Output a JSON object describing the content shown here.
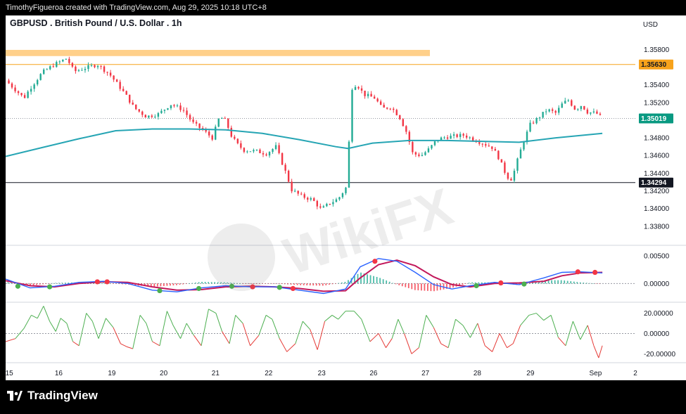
{
  "header": {
    "caption": "TimothyFigueroa created with TradingView.com, Aug 29, 2025 10:18 UTC+8"
  },
  "chart": {
    "title": "GBPUSD . British Pound / U.S. Dollar . 1h",
    "currency": "USD"
  },
  "footer": {
    "brand": "TradingView"
  },
  "watermark": {
    "text": "WikiFX"
  },
  "colors": {
    "up": "#22ab94",
    "down": "#f23645",
    "ma": "#26a5b4",
    "resistance_zone": "#ffd08a",
    "resistance_badge": "#f7a21b",
    "last_price_badge": "#089981",
    "support_badge": "#131722",
    "macd_line": "#2962ff",
    "signal_line": "#c2185b",
    "osc_up": "#4caf50",
    "osc_down": "#e53935"
  },
  "chart_data": {
    "type": "candlestick",
    "symbol": "GBPUSD",
    "timeframe": "1h",
    "y_ticks": [
      "1.35800",
      "1.35400",
      "1.35200",
      "1.34800",
      "1.34600",
      "1.34400",
      "1.34200",
      "1.34000",
      "1.33800"
    ],
    "ylim": [
      1.336,
      1.3593
    ],
    "x_ticks": [
      "15",
      "16",
      "19",
      "20",
      "21",
      "22",
      "23",
      "26",
      "27",
      "28",
      "29",
      "Sep",
      "2"
    ],
    "price_labels": {
      "resistance": "1.35630",
      "last": "1.35019",
      "support": "1.34294"
    },
    "levels": {
      "resistance": 1.3563,
      "last": 1.35019,
      "support": 1.34294,
      "zone_high": 1.35795,
      "zone_low": 1.35725
    },
    "price_path": [
      [
        0,
        1.3545
      ],
      [
        1.5,
        1.3525
      ],
      [
        2,
        1.3536
      ],
      [
        3,
        1.3554
      ],
      [
        4,
        1.3563
      ],
      [
        5,
        1.357
      ],
      [
        5.6,
        1.3555
      ],
      [
        6.5,
        1.3559
      ],
      [
        7.5,
        1.3563
      ],
      [
        8.5,
        1.3552
      ],
      [
        9.3,
        1.3538
      ],
      [
        9.8,
        1.3529
      ],
      [
        10.5,
        1.3514
      ],
      [
        11.5,
        1.3504
      ],
      [
        12.5,
        1.3507
      ],
      [
        13.5,
        1.3518
      ],
      [
        14.5,
        1.3512
      ],
      [
        15.3,
        1.3497
      ],
      [
        16.2,
        1.3488
      ],
      [
        16.9,
        1.348
      ],
      [
        17.5,
        1.3504
      ],
      [
        18,
        1.3499
      ],
      [
        18.5,
        1.3481
      ],
      [
        19,
        1.3472
      ],
      [
        19.5,
        1.3466
      ],
      [
        20.5,
        1.3465
      ],
      [
        21.3,
        1.3462
      ],
      [
        22.1,
        1.347
      ],
      [
        22.8,
        1.3445
      ],
      [
        23.4,
        1.3421
      ],
      [
        24.2,
        1.3414
      ],
      [
        25.1,
        1.341
      ],
      [
        25.8,
        1.3399
      ],
      [
        26.5,
        1.3406
      ],
      [
        27.2,
        1.3411
      ],
      [
        27.9,
        1.3425
      ],
      [
        28.3,
        1.3536
      ],
      [
        28.7,
        1.3541
      ],
      [
        29.3,
        1.3529
      ],
      [
        30.2,
        1.3525
      ],
      [
        30.8,
        1.3513
      ],
      [
        31.5,
        1.3515
      ],
      [
        32.2,
        1.3504
      ],
      [
        32.8,
        1.3486
      ],
      [
        33.3,
        1.3462
      ],
      [
        34,
        1.346
      ],
      [
        34.6,
        1.3467
      ],
      [
        35.3,
        1.3478
      ],
      [
        36,
        1.3481
      ],
      [
        36.8,
        1.3482
      ],
      [
        37.5,
        1.3483
      ],
      [
        38.3,
        1.3478
      ],
      [
        39,
        1.3474
      ],
      [
        39.8,
        1.3469
      ],
      [
        40.3,
        1.3458
      ],
      [
        41,
        1.3436
      ],
      [
        41.4,
        1.3433
      ],
      [
        41.8,
        1.3452
      ],
      [
        42.3,
        1.3474
      ],
      [
        42.9,
        1.3495
      ],
      [
        43.6,
        1.3503
      ],
      [
        44.3,
        1.3512
      ],
      [
        45,
        1.3508
      ],
      [
        45.5,
        1.3518
      ],
      [
        46,
        1.3523
      ],
      [
        46.6,
        1.3512
      ],
      [
        47.1,
        1.3517
      ],
      [
        47.6,
        1.3509
      ],
      [
        48.3,
        1.3508
      ],
      [
        48.8,
        1.3502
      ]
    ],
    "ma_path": [
      [
        0,
        1.3459
      ],
      [
        3,
        1.3469
      ],
      [
        6,
        1.3479
      ],
      [
        9,
        1.3488
      ],
      [
        12,
        1.349
      ],
      [
        15,
        1.349
      ],
      [
        18,
        1.3489
      ],
      [
        21,
        1.3485
      ],
      [
        24,
        1.3478
      ],
      [
        27,
        1.347
      ],
      [
        28,
        1.3468
      ],
      [
        30,
        1.3474
      ],
      [
        33,
        1.3477
      ],
      [
        36,
        1.3477
      ],
      [
        39,
        1.3476
      ],
      [
        42,
        1.3475
      ],
      [
        45,
        1.348
      ],
      [
        48.8,
        1.3485
      ]
    ],
    "x_span": [
      0,
      51.5
    ],
    "macd": {
      "y_ticks": [
        "0.00500",
        "0.00000"
      ],
      "ylim": [
        -0.003,
        0.0065
      ],
      "macd_path": [
        [
          0,
          0.0008
        ],
        [
          2,
          -0.0008
        ],
        [
          4,
          -0.0005
        ],
        [
          6,
          0.0002
        ],
        [
          8,
          0.0004
        ],
        [
          10,
          0.0
        ],
        [
          12,
          -0.0012
        ],
        [
          14,
          -0.0015
        ],
        [
          16,
          -0.0008
        ],
        [
          18,
          -0.0004
        ],
        [
          20,
          -0.0006
        ],
        [
          22,
          -0.0006
        ],
        [
          24,
          -0.0012
        ],
        [
          26,
          -0.0018
        ],
        [
          27.8,
          -0.001
        ],
        [
          29,
          0.003
        ],
        [
          30.5,
          0.0045
        ],
        [
          32,
          0.004
        ],
        [
          33.5,
          0.002
        ],
        [
          35,
          -0.0002
        ],
        [
          36.5,
          -0.001
        ],
        [
          38,
          -0.0004
        ],
        [
          40,
          0.0002
        ],
        [
          42,
          -0.0002
        ],
        [
          44,
          0.001
        ],
        [
          45.5,
          0.002
        ],
        [
          47,
          0.0021
        ],
        [
          48.8,
          0.0019
        ]
      ],
      "signal_path": [
        [
          0,
          0.0005
        ],
        [
          2,
          -0.0004
        ],
        [
          4,
          -0.0006
        ],
        [
          6,
          0.0
        ],
        [
          8,
          0.0003
        ],
        [
          10,
          0.0002
        ],
        [
          12,
          -0.0006
        ],
        [
          14,
          -0.0012
        ],
        [
          16,
          -0.0011
        ],
        [
          18,
          -0.0006
        ],
        [
          20,
          -0.0005
        ],
        [
          22,
          -0.0006
        ],
        [
          24,
          -0.0009
        ],
        [
          26,
          -0.0014
        ],
        [
          27.8,
          -0.0013
        ],
        [
          29,
          0.001
        ],
        [
          30.5,
          0.0034
        ],
        [
          32,
          0.0042
        ],
        [
          33.5,
          0.0032
        ],
        [
          35,
          0.0012
        ],
        [
          36.5,
          -0.0002
        ],
        [
          38,
          -0.0006
        ],
        [
          40,
          0.0
        ],
        [
          42,
          0.0001
        ],
        [
          44,
          0.0004
        ],
        [
          45.5,
          0.0014
        ],
        [
          47,
          0.0019
        ],
        [
          48.8,
          0.002
        ]
      ],
      "cross_markers": [
        [
          1,
          -0.0005,
          "up"
        ],
        [
          3.6,
          -0.0006,
          "up"
        ],
        [
          7.5,
          0.0003,
          "down"
        ],
        [
          8.3,
          0.0003,
          "down"
        ],
        [
          12.6,
          -0.0013,
          "up"
        ],
        [
          15.8,
          -0.0009,
          "up"
        ],
        [
          18.5,
          -0.0005,
          "up"
        ],
        [
          20.2,
          -0.0006,
          "down"
        ],
        [
          22.4,
          -0.0007,
          "up"
        ],
        [
          23.5,
          -0.0009,
          "down"
        ],
        [
          30.2,
          0.004,
          "down"
        ],
        [
          38.5,
          -0.0004,
          "up"
        ],
        [
          40.5,
          0.0001,
          "down"
        ],
        [
          42.4,
          -0.0001,
          "up"
        ],
        [
          46.8,
          0.0021,
          "down"
        ],
        [
          48.2,
          0.002,
          "down"
        ]
      ]
    },
    "oscillator": {
      "y_ticks": [
        "20.00000",
        "0.00000",
        "-20.00000"
      ],
      "ylim": [
        -26,
        28
      ],
      "path": [
        [
          0,
          -8
        ],
        [
          0.8,
          -5
        ],
        [
          1.5,
          5
        ],
        [
          2.1,
          18
        ],
        [
          2.6,
          15
        ],
        [
          3.1,
          27
        ],
        [
          3.6,
          12
        ],
        [
          4.1,
          2
        ],
        [
          4.5,
          15
        ],
        [
          5,
          10
        ],
        [
          5.5,
          -8
        ],
        [
          6,
          -12
        ],
        [
          6.6,
          20
        ],
        [
          7.1,
          12
        ],
        [
          7.6,
          -5
        ],
        [
          8.2,
          15
        ],
        [
          8.8,
          6
        ],
        [
          9.4,
          -10
        ],
        [
          9.9,
          -13
        ],
        [
          10.4,
          -15
        ],
        [
          11,
          18
        ],
        [
          11.5,
          10
        ],
        [
          12,
          -8
        ],
        [
          12.6,
          -12
        ],
        [
          13.2,
          22
        ],
        [
          13.7,
          8
        ],
        [
          14.3,
          -5
        ],
        [
          14.8,
          10
        ],
        [
          15.4,
          -2
        ],
        [
          16,
          -12
        ],
        [
          16.6,
          24
        ],
        [
          17.2,
          20
        ],
        [
          17.7,
          2
        ],
        [
          18.3,
          -10
        ],
        [
          18.8,
          18
        ],
        [
          19.4,
          10
        ],
        [
          20,
          -12
        ],
        [
          20.7,
          -2
        ],
        [
          21.3,
          18
        ],
        [
          21.8,
          14
        ],
        [
          22.4,
          -5
        ],
        [
          23,
          -18
        ],
        [
          23.7,
          -10
        ],
        [
          24.3,
          12
        ],
        [
          24.9,
          4
        ],
        [
          25.5,
          -16
        ],
        [
          26.1,
          12
        ],
        [
          26.7,
          18
        ],
        [
          27.2,
          14
        ],
        [
          27.8,
          22
        ],
        [
          28.5,
          22
        ],
        [
          29.1,
          14
        ],
        [
          29.8,
          -8
        ],
        [
          30.5,
          0
        ],
        [
          31.1,
          -14
        ],
        [
          31.6,
          -5
        ],
        [
          32.1,
          14
        ],
        [
          32.6,
          0
        ],
        [
          33.2,
          -20
        ],
        [
          33.8,
          -14
        ],
        [
          34.4,
          18
        ],
        [
          35,
          6
        ],
        [
          35.6,
          -10
        ],
        [
          36.2,
          -14
        ],
        [
          36.8,
          14
        ],
        [
          37.4,
          8
        ],
        [
          38,
          -4
        ],
        [
          38.6,
          10
        ],
        [
          39.2,
          -12
        ],
        [
          39.8,
          -18
        ],
        [
          40.4,
          0
        ],
        [
          41,
          -14
        ],
        [
          41.5,
          -10
        ],
        [
          42.1,
          8
        ],
        [
          42.8,
          18
        ],
        [
          43.4,
          20
        ],
        [
          44,
          13
        ],
        [
          44.6,
          18
        ],
        [
          45.2,
          -4
        ],
        [
          45.8,
          -12
        ],
        [
          46.4,
          12
        ],
        [
          47,
          -6
        ],
        [
          47.6,
          8
        ],
        [
          48.1,
          -12
        ],
        [
          48.5,
          -24
        ],
        [
          48.8,
          -12
        ]
      ]
    }
  }
}
